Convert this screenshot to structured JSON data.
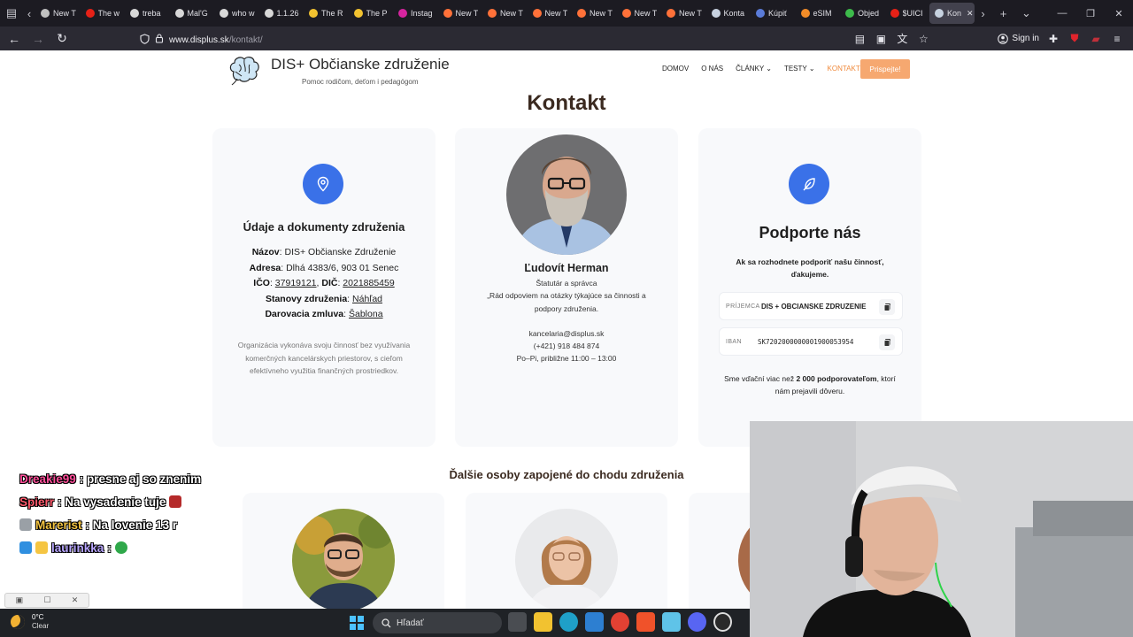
{
  "browser": {
    "tabs": [
      {
        "title": "New T",
        "color": "#c0c0c0"
      },
      {
        "title": "The w",
        "color": "#e62117"
      },
      {
        "title": "treba",
        "color": "#d8d8d8"
      },
      {
        "title": "Mal'G",
        "color": "#d8d8d8"
      },
      {
        "title": "who w",
        "color": "#d8d8d8"
      },
      {
        "title": "1.1.26",
        "color": "#d8d8d8"
      },
      {
        "title": "The R",
        "color": "#f2c230"
      },
      {
        "title": "The P",
        "color": "#f2c230"
      },
      {
        "title": "Instag",
        "color": "#d6249f"
      },
      {
        "title": "New T",
        "color": "#ff7139"
      },
      {
        "title": "New T",
        "color": "#ff7139"
      },
      {
        "title": "New T",
        "color": "#ff7139"
      },
      {
        "title": "New T",
        "color": "#ff7139"
      },
      {
        "title": "New T",
        "color": "#ff7139"
      },
      {
        "title": "New T",
        "color": "#ff7139"
      },
      {
        "title": "Konta",
        "color": "#c7d2e0"
      },
      {
        "title": "Kúpiť",
        "color": "#5a7bd8"
      },
      {
        "title": "eSIM",
        "color": "#f28c28"
      },
      {
        "title": "Objed",
        "color": "#3dbb4b"
      },
      {
        "title": "$UICI",
        "color": "#e62117"
      },
      {
        "title": "Kon",
        "color": "#c7d2e0"
      }
    ],
    "url_host": "www.displus.sk",
    "url_path": "/kontakt/",
    "sign_in": "Sign in"
  },
  "site": {
    "title": "DIS+ Občianske združenie",
    "tagline": "Pomoc rodičom, deťom i pedagógom",
    "menu": [
      "DOMOV",
      "O NÁS",
      "ČLÁNKY",
      "TESTY",
      "KONTAKT"
    ],
    "cta": "Prispejte!"
  },
  "page": {
    "heading": "Kontakt",
    "card1": {
      "title": "Údaje a dokumenty združenia",
      "name_label": "Názov",
      "name_value": ": DIS+ Občianske Združenie",
      "address_label": "Adresa",
      "address_value": ": Dlhá 4383/6, 903 01 Senec",
      "ico_label": "IČO",
      "ico_value": "37919121",
      "dic_label": "DIČ",
      "dic_value": "2021885459",
      "statutes_label": "Stanovy združenia",
      "statutes_link": "Náhľad",
      "donation_label": "Darovacia zmluva",
      "donation_link": "Šablona",
      "note": "Organizácia vykonáva svoju činnosť bez využívania komerčných kancelárskych priestorov, s cieľom efektívneho využitia finančných prostriedkov."
    },
    "card2": {
      "name": "Ľudovít Herman",
      "role": "Štatutár a správca",
      "quote_1": "„Rád odpoviem na otázky týkajúce sa činnosti a",
      "quote_2": "podpory združenia.",
      "email": "kancelaria@displus.sk",
      "phone": "(+421) 918 484 874",
      "hours": "Po–Pi, približne 11:00 – 13:00"
    },
    "card3": {
      "title": "Podporte nás",
      "intro_1": "Ak sa rozhodnete podporiť našu činnosť,",
      "intro_2": "ďakujeme.",
      "recipient_label": "PRÍJEMCA",
      "recipient_value": "DIS + OBCIANSKE ZDRUZENIE",
      "iban_label": "IBAN",
      "iban_value": "SK7202000000001900053954",
      "thanks_1a": "Sme vďační viac než ",
      "thanks_1b": "2 000 podporovateľom",
      "thanks_1c": ", ktorí",
      "thanks_2": "nám prejavili dôveru."
    },
    "others_heading": "Ďalšie osoby zapojené do chodu združenia"
  },
  "chat": [
    {
      "user": "Dreakie99",
      "message": ": presne aj so znenim",
      "color": "#ff4f9a"
    },
    {
      "user": "Spierr",
      "message": ": Na vysadenie tuje",
      "color": "#ff5b6e"
    },
    {
      "user": "Marerist",
      "message": ": Na lovenie 13 r",
      "color": "#f5c542"
    },
    {
      "user": "laurinkka",
      "message": ":",
      "color": "#b9a7ff"
    }
  ],
  "taskbar": {
    "temp": "0°C",
    "condition": "Clear",
    "search": "Hľadať"
  }
}
